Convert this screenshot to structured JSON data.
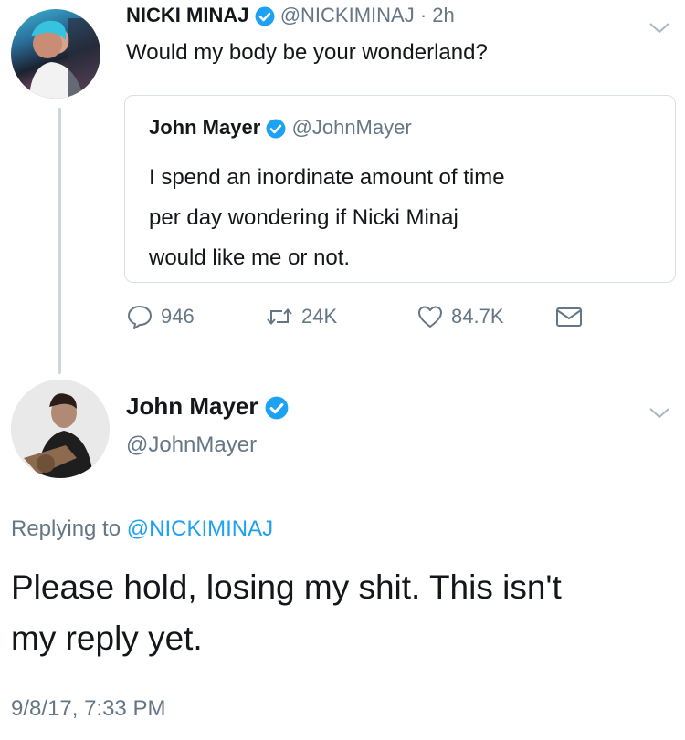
{
  "tweet": {
    "display_name": "NICKI MINAJ",
    "handle_time": "@NICKIMINAJ · 2h",
    "text": "Would my body be your wonderland?",
    "quoted": {
      "display_name": "John Mayer",
      "handle": "@JohnMayer",
      "text_line1": "I spend an inordinate amount of time",
      "text_line2": "per day wondering if Nicki Minaj",
      "text_line3": "would like me or not."
    },
    "actions": {
      "replies": "946",
      "retweets": "24K",
      "likes": "84.7K"
    }
  },
  "reply": {
    "display_name": "John Mayer",
    "handle": "@JohnMayer",
    "replying_prefix": "Replying to",
    "replying_handle": "@NICKIMINAJ",
    "text_line1": "Please hold, losing my shit. This isn't",
    "text_line2": "my reply yet.",
    "timestamp": "9/8/17, 7:33 PM"
  },
  "colors": {
    "verified": "#1da1f2",
    "link": "#1da1f2",
    "muted": "#657786",
    "border": "#ccd6dd"
  },
  "icons": [
    "verified-badge-icon",
    "chevron-down-icon",
    "reply-icon",
    "retweet-icon",
    "like-icon",
    "dm-icon"
  ]
}
